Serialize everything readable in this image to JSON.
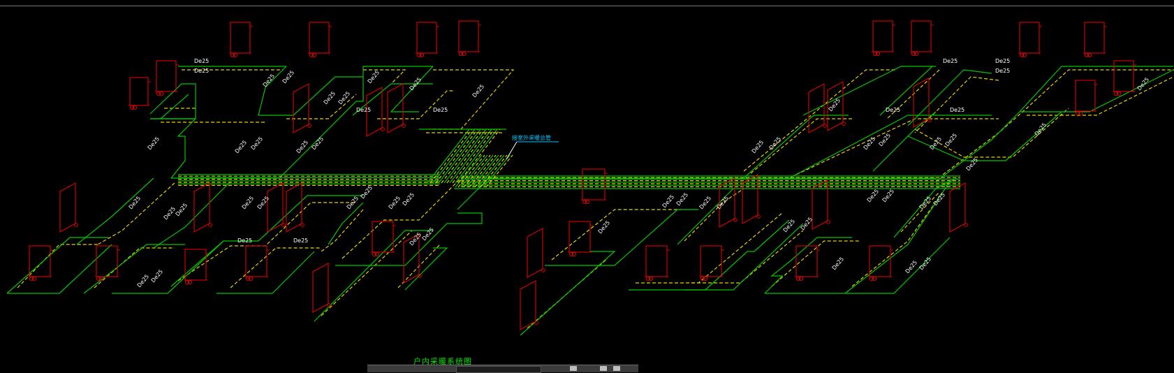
{
  "diagram": {
    "pipe_label": "De25",
    "callout": "接室外采暖总管",
    "caption": "户内采暖系统图"
  },
  "colors": {
    "background": "#000000",
    "supply_pipe": "#00c800",
    "return_pipe": "#e6d200",
    "radiator": "#e00000",
    "label": "#ffffff",
    "callout": "#00c8ff",
    "caption": "#00e600"
  },
  "icons": {
    "radiator": "radiator-icon",
    "valve": "valve-icon"
  }
}
